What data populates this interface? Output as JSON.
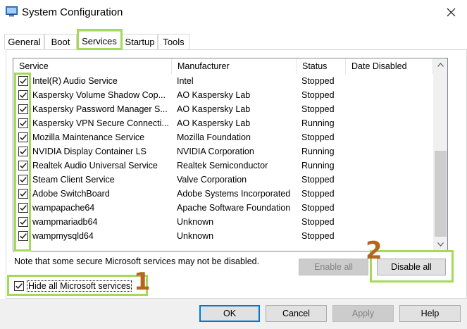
{
  "window": {
    "title": "System Configuration"
  },
  "tabs": [
    {
      "label": "General",
      "active": false
    },
    {
      "label": "Boot",
      "active": false
    },
    {
      "label": "Services",
      "active": true
    },
    {
      "label": "Startup",
      "active": false
    },
    {
      "label": "Tools",
      "active": false
    }
  ],
  "services_table": {
    "columns": [
      "Service",
      "Manufacturer",
      "Status",
      "Date Disabled"
    ],
    "rows": [
      {
        "checked": true,
        "service": "Intel(R) Audio Service",
        "manufacturer": "Intel",
        "status": "Stopped",
        "date_disabled": ""
      },
      {
        "checked": true,
        "service": "Kaspersky Volume Shadow Cop...",
        "manufacturer": "AO Kaspersky Lab",
        "status": "Stopped",
        "date_disabled": ""
      },
      {
        "checked": true,
        "service": "Kaspersky Password Manager S...",
        "manufacturer": "AO Kaspersky Lab",
        "status": "Stopped",
        "date_disabled": ""
      },
      {
        "checked": true,
        "service": "Kaspersky VPN Secure Connecti...",
        "manufacturer": "AO Kaspersky Lab",
        "status": "Running",
        "date_disabled": ""
      },
      {
        "checked": true,
        "service": "Mozilla Maintenance Service",
        "manufacturer": "Mozilla Foundation",
        "status": "Stopped",
        "date_disabled": ""
      },
      {
        "checked": true,
        "service": "NVIDIA Display Container LS",
        "manufacturer": "NVIDIA Corporation",
        "status": "Running",
        "date_disabled": ""
      },
      {
        "checked": true,
        "service": "Realtek Audio Universal Service",
        "manufacturer": "Realtek Semiconductor",
        "status": "Running",
        "date_disabled": ""
      },
      {
        "checked": true,
        "service": "Steam Client Service",
        "manufacturer": "Valve Corporation",
        "status": "Stopped",
        "date_disabled": ""
      },
      {
        "checked": true,
        "service": "Adobe SwitchBoard",
        "manufacturer": "Adobe Systems Incorporated",
        "status": "Stopped",
        "date_disabled": ""
      },
      {
        "checked": true,
        "service": "wampapache64",
        "manufacturer": "Apache Software Foundation",
        "status": "Stopped",
        "date_disabled": ""
      },
      {
        "checked": true,
        "service": "wampmariadb64",
        "manufacturer": "Unknown",
        "status": "Stopped",
        "date_disabled": ""
      },
      {
        "checked": true,
        "service": "wampmysqld64",
        "manufacturer": "Unknown",
        "status": "Stopped",
        "date_disabled": ""
      }
    ]
  },
  "note": "Note that some secure Microsoft services may not be disabled.",
  "hide_ms": {
    "label": "Hide all Microsoft services",
    "checked": true
  },
  "buttons": {
    "enable_all": "Enable all",
    "disable_all": "Disable all",
    "ok": "OK",
    "cancel": "Cancel",
    "apply": "Apply",
    "help": "Help"
  },
  "annotations": {
    "step1": "1",
    "step2": "2"
  },
  "colors": {
    "highlight": "#a4d95a",
    "step_number": "#b5651d",
    "primary_border": "#0078d7"
  }
}
